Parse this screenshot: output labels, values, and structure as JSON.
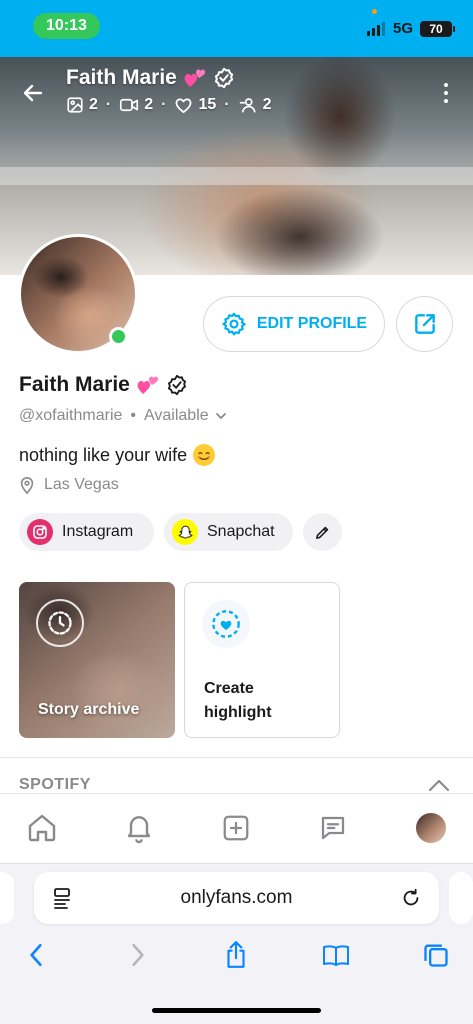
{
  "status": {
    "time": "10:13",
    "network": "5G",
    "battery": "70"
  },
  "cover": {
    "name": "Faith Marie",
    "stats": [
      {
        "icon": "image-icon",
        "value": "2"
      },
      {
        "icon": "video-icon",
        "value": "2"
      },
      {
        "icon": "heart-icon",
        "value": "15"
      },
      {
        "icon": "fans-icon",
        "value": "2"
      }
    ]
  },
  "profile": {
    "name": "Faith Marie",
    "handle": "@xofaithmarie",
    "availability": "Available",
    "bio": "nothing like your wife",
    "location": "Las Vegas",
    "edit_label": "EDIT PROFILE"
  },
  "socials": [
    {
      "name": "Instagram",
      "color": "#e1306c"
    },
    {
      "name": "Snapchat",
      "color": "#fffc00"
    }
  ],
  "highlights": {
    "archive_label": "Story archive",
    "create_label": "Create highlight"
  },
  "sections": {
    "spotify": "SPOTIFY"
  },
  "browser": {
    "url": "onlyfans.com"
  },
  "colors": {
    "accent": "#00aff0",
    "online": "#34c759",
    "verified_heart": "#ff4fa3"
  }
}
